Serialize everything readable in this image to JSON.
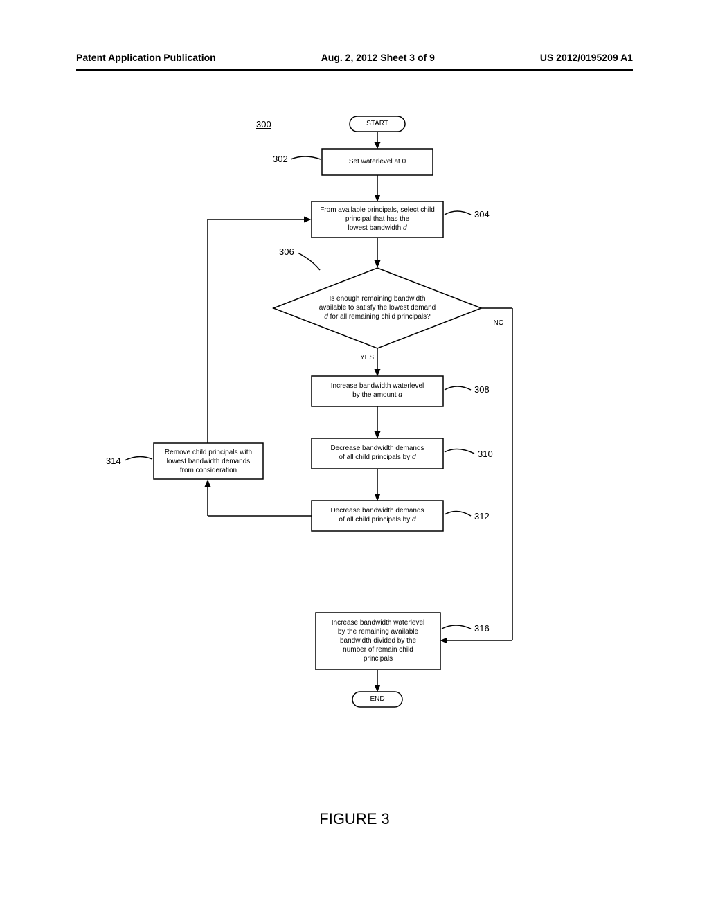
{
  "header": {
    "left": "Patent Application Publication",
    "center": "Aug. 2, 2012  Sheet 3 of 9",
    "right": "US 2012/0195209 A1"
  },
  "diagram": {
    "ref_main": "300",
    "start": "START",
    "end": "END",
    "step302": {
      "ref": "302",
      "text": "Set waterlevel at 0"
    },
    "step304": {
      "ref": "304",
      "text_line1": "From available principals, select child",
      "text_line2": "principal that has the",
      "text_line3_pre": "lowest bandwidth ",
      "text_line3_italic": "d"
    },
    "step306": {
      "ref": "306",
      "text_line1": "Is enough remaining bandwidth",
      "text_line2": "available to satisfy the lowest demand",
      "text_line3_italic": "d",
      "text_line3_post": " for all remaining child principals?",
      "yes": "YES",
      "no": "NO"
    },
    "step308": {
      "ref": "308",
      "text_line1": "Increase bandwidth waterlevel",
      "text_line2_pre": "by the amount ",
      "text_line2_italic": "d"
    },
    "step310": {
      "ref": "310",
      "text_line1": "Decrease bandwidth demands",
      "text_line2_pre": "of all child principals by ",
      "text_line2_italic": "d"
    },
    "step312": {
      "ref": "312",
      "text_line1": "Decrease bandwidth demands",
      "text_line2_pre": "of all child principals by ",
      "text_line2_italic": "d"
    },
    "step314": {
      "ref": "314",
      "text_line1": "Remove child principals with",
      "text_line2": "lowest bandwidth demands",
      "text_line3": "from consideration"
    },
    "step316": {
      "ref": "316",
      "text_line1": "Increase bandwidth waterlevel",
      "text_line2": "by the remaining available",
      "text_line3": "bandwidth divided by the",
      "text_line4": "number of remain child",
      "text_line5": "principals"
    }
  },
  "figure_title": "FIGURE 3"
}
